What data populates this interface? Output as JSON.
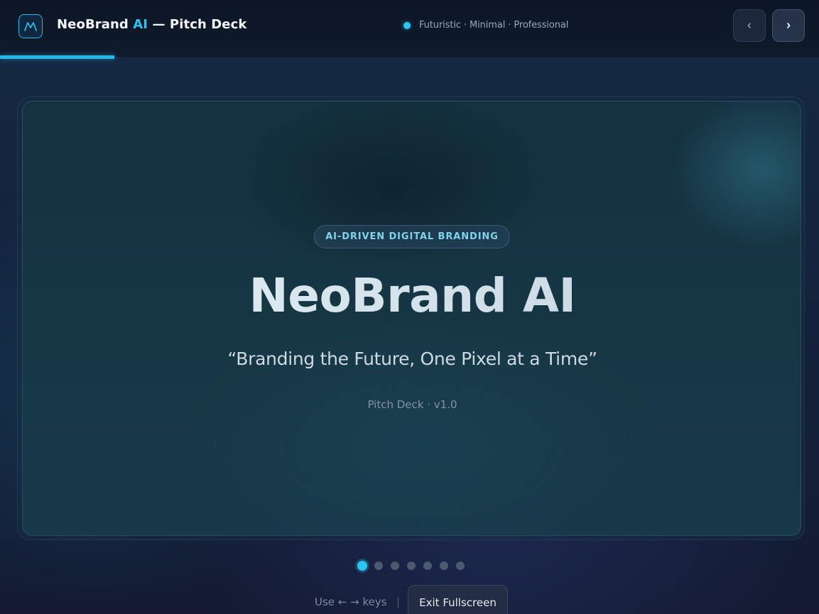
{
  "header": {
    "brand_name": "NeoBrand",
    "brand_accent": "AI",
    "brand_suffix": " — Pitch Deck",
    "status_text": "Futuristic · Minimal · Professional",
    "logo_icon": "m-logo-icon",
    "prev_icon": "chevron-left-icon",
    "next_icon": "chevron-right-icon"
  },
  "progress": {
    "current_slide": 1,
    "total_slides": 7,
    "fraction": 0.14
  },
  "slide": {
    "badge": "AI-DRIVEN DIGITAL BRANDING",
    "title": "NeoBrand AI",
    "tagline": "“Branding the Future, One Pixel at a Time”",
    "meta": "Pitch Deck · v1.0"
  },
  "pagination": {
    "count": 7,
    "active_index": 0
  },
  "footer": {
    "hint": "Use ← → keys",
    "separator": "|",
    "exit_label": "Exit Fullscreen"
  },
  "colors": {
    "accent": "#2bc4ef",
    "background": "#14223d",
    "dot_inactive": "#4d5a6e"
  }
}
